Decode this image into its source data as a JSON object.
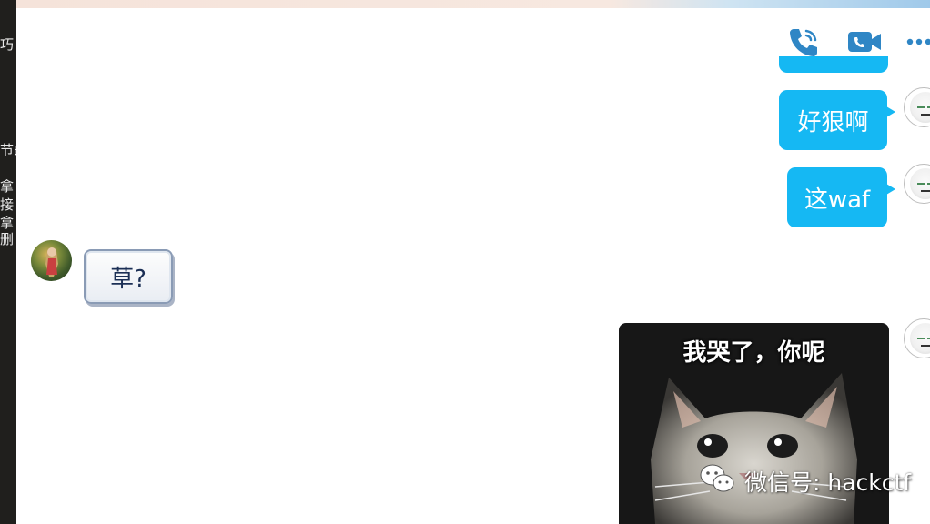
{
  "left_strip": {
    "fragments": [
      "巧",
      "节的",
      "拿",
      "接",
      "拿",
      "删"
    ]
  },
  "header": {
    "icons": [
      "phone-icon",
      "video-call-icon",
      "more-icon"
    ],
    "icon_color": "#2f86c5"
  },
  "messages": [
    {
      "side": "out",
      "text": "好狠啊"
    },
    {
      "side": "out",
      "text": "这waf"
    },
    {
      "side": "in",
      "text": "草?"
    },
    {
      "side": "out",
      "type": "sticker",
      "caption": "我哭了，你呢"
    }
  ],
  "watermark": {
    "text": "微信号: hackctf",
    "icon": "wechat-icon"
  },
  "colors": {
    "outgoing_bubble": "#15b8f3",
    "incoming_bubble_border": "#8a9bb5"
  }
}
